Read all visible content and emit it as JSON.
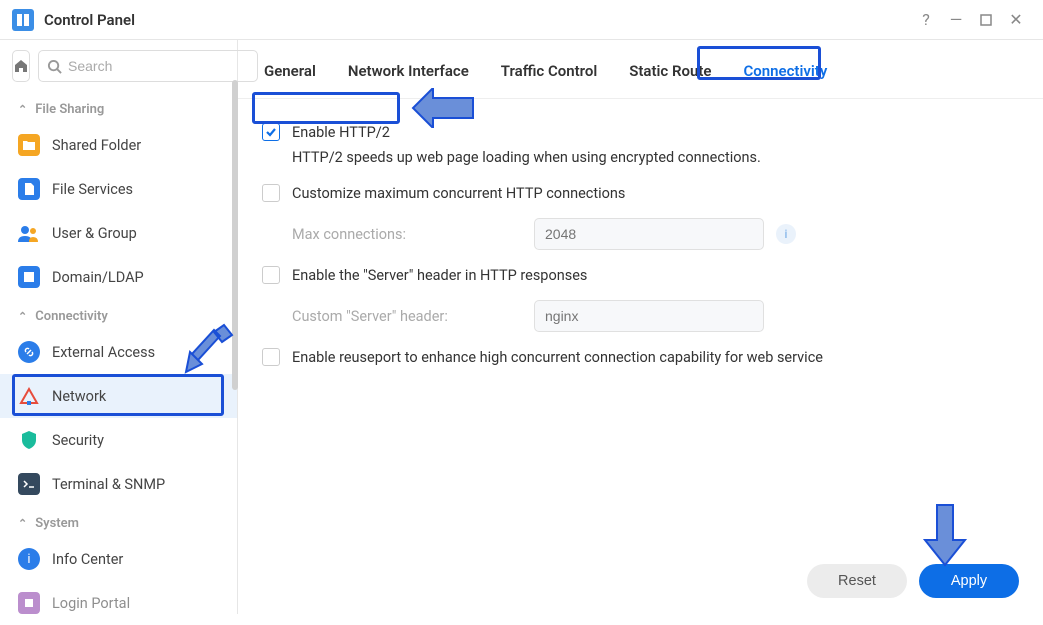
{
  "window": {
    "title": "Control Panel"
  },
  "search": {
    "placeholder": "Search"
  },
  "sections": {
    "file_sharing": "File Sharing",
    "connectivity": "Connectivity",
    "system": "System"
  },
  "sidebar": {
    "file_sharing": [
      {
        "label": "Shared Folder"
      },
      {
        "label": "File Services"
      },
      {
        "label": "User & Group"
      },
      {
        "label": "Domain/LDAP"
      }
    ],
    "connectivity": [
      {
        "label": "External Access"
      },
      {
        "label": "Network"
      },
      {
        "label": "Security"
      },
      {
        "label": "Terminal & SNMP"
      }
    ],
    "system": [
      {
        "label": "Info Center"
      },
      {
        "label": "Login Portal"
      }
    ]
  },
  "tabs": {
    "general": "General",
    "network_interface": "Network Interface",
    "traffic_control": "Traffic Control",
    "static_route": "Static Route",
    "connectivity": "Connectivity"
  },
  "settings": {
    "enable_http2": {
      "label": "Enable HTTP/2",
      "help": "HTTP/2 speeds up web page loading when using encrypted connections."
    },
    "customize_max": {
      "label": "Customize maximum concurrent HTTP connections",
      "sub_label": "Max connections:",
      "value": "2048"
    },
    "server_header": {
      "label": "Enable the \"Server\" header in HTTP responses",
      "sub_label": "Custom \"Server\" header:",
      "value": "nginx"
    },
    "reuseport": {
      "label": "Enable reuseport to enhance high concurrent connection capability for web service"
    }
  },
  "buttons": {
    "reset": "Reset",
    "apply": "Apply"
  }
}
